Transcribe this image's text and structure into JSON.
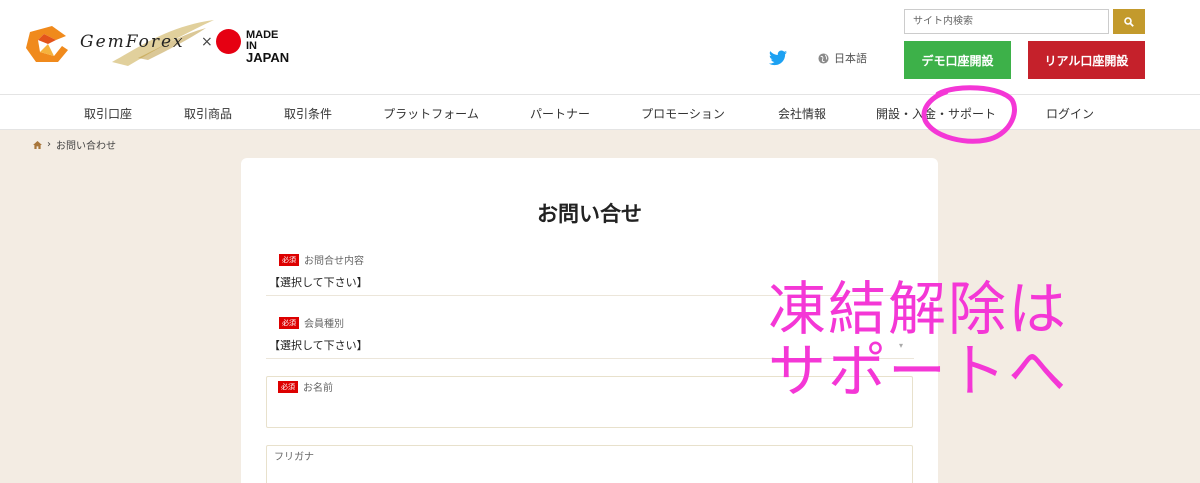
{
  "header": {
    "logo_text": "GemForex",
    "logo_times": "×",
    "made_in": "MADE IN",
    "japan": "JAPAN",
    "search_placeholder": "サイト内検索",
    "language": "日本語",
    "demo_button": "デモ口座開設",
    "real_button": "リアル口座開設"
  },
  "nav": {
    "items": [
      "取引口座",
      "取引商品",
      "取引条件",
      "プラットフォーム",
      "パートナー",
      "プロモーション",
      "会社情報",
      "開設・入金・サポート",
      "ログイン"
    ]
  },
  "breadcrumb": {
    "current": "お問い合わせ"
  },
  "form": {
    "title": "お問い合せ",
    "required_badge": "必須",
    "fields": [
      {
        "label": "お問合せ内容",
        "value": "【選択して下さい】"
      },
      {
        "label": "会員種別",
        "value": "【選択して下さい】"
      },
      {
        "label": "お名前"
      },
      {
        "label": "フリガナ"
      }
    ]
  },
  "annotation": {
    "line1": "凍結解除は",
    "line2": "サポートへ",
    "color": "#f437d6"
  },
  "colors": {
    "demo_green": "#3db149",
    "real_red": "#c5212b",
    "search_gold": "#c39a2c",
    "background": "#f3ece3"
  }
}
